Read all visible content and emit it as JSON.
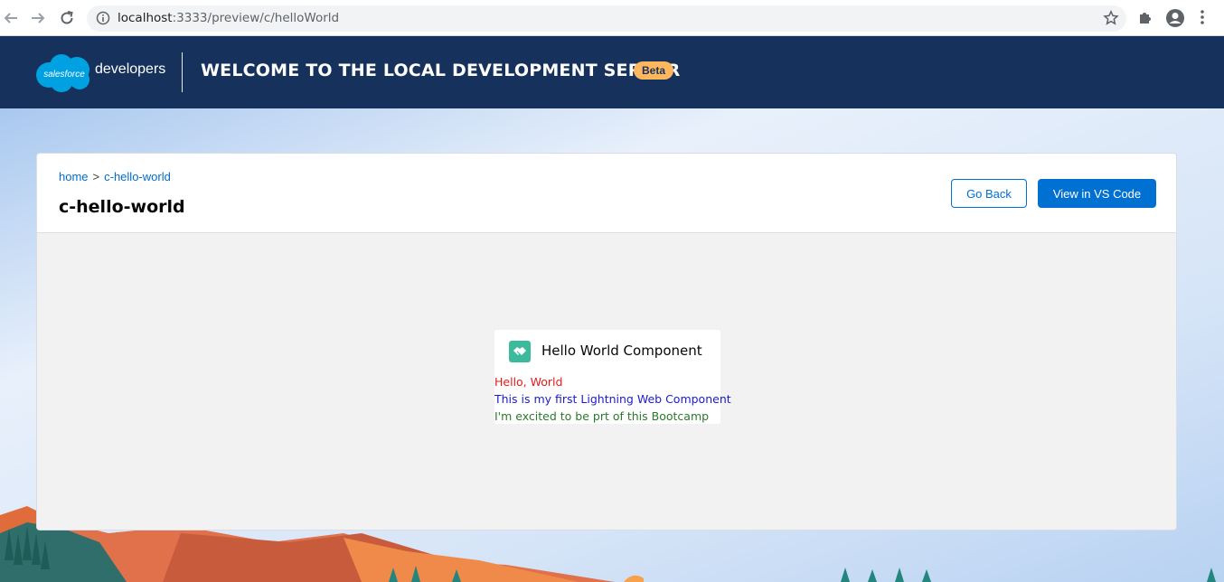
{
  "browser": {
    "url_host": "localhost",
    "url_rest": ":3333/preview/c/helloWorld"
  },
  "header": {
    "brand": "developers",
    "title": "WELCOME TO THE LOCAL DEVELOPMENT SERVER",
    "badge": "Beta",
    "color": "#16325c"
  },
  "breadcrumb": {
    "home": "home",
    "separator": ">",
    "current": "c-hello-world"
  },
  "page": {
    "title": "c-hello-world",
    "back_label": "Go Back",
    "vscode_label": "View in VS Code"
  },
  "component": {
    "icon": "handshake-icon",
    "title": "Hello World Component",
    "line1": "Hello, World",
    "line2": "This is my first Lightning Web Component",
    "line3": "I'm excited to be prt of this Bootcamp"
  }
}
